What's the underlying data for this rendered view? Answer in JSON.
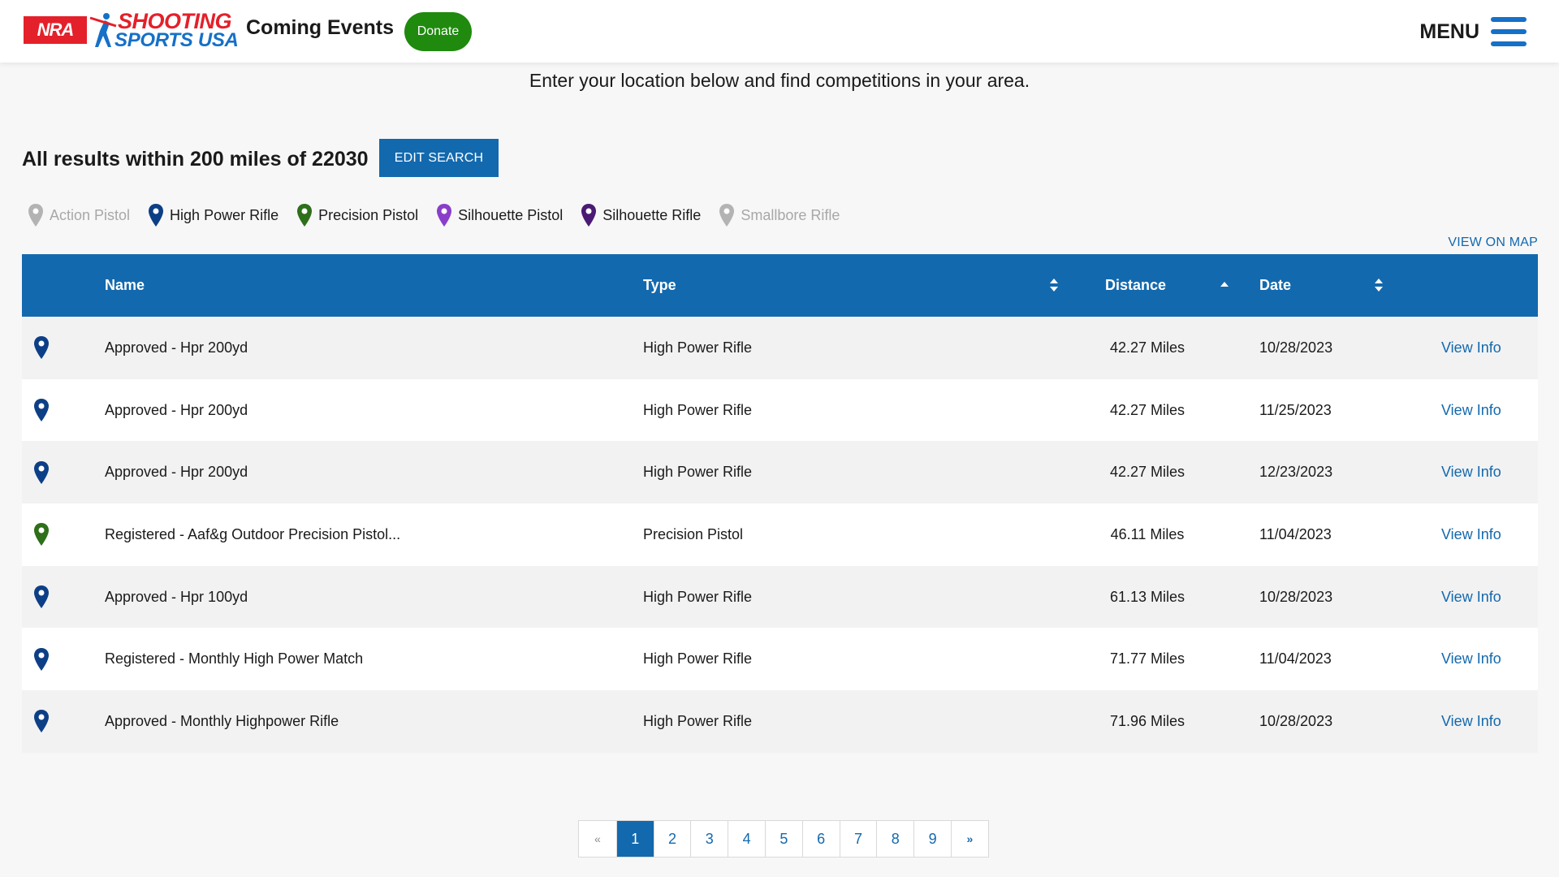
{
  "header": {
    "logo_nra": "NRA",
    "logo_top": "SHOOTING",
    "logo_bottom": "SPORTS USA",
    "title": "Coming Events",
    "donate_label": "Donate",
    "menu_label": "MENU"
  },
  "intro": "Enter your location below and find competitions in your area.",
  "results": {
    "heading": "All results within 200 miles of 22030",
    "edit_label": "EDIT SEARCH"
  },
  "legend": [
    {
      "label": "Action Pistol",
      "color": "#b3b3b3",
      "active": false
    },
    {
      "label": "High Power Rifle",
      "color": "#0d3f86",
      "active": true
    },
    {
      "label": "Precision Pistol",
      "color": "#2e6f1a",
      "active": true
    },
    {
      "label": "Silhouette Pistol",
      "color": "#8a3ec9",
      "active": true
    },
    {
      "label": "Silhouette Rifle",
      "color": "#4a1a74",
      "active": true
    },
    {
      "label": "Smallbore Rifle",
      "color": "#b3b3b3",
      "active": false
    }
  ],
  "view_map_label": "VIEW ON MAP",
  "table": {
    "columns": {
      "name": "Name",
      "type": "Type",
      "distance": "Distance",
      "date": "Date"
    },
    "rows": [
      {
        "pin_color": "#0d3f86",
        "name": "Approved - Hpr 200yd",
        "type": "High Power Rifle",
        "distance": "42.27 Miles",
        "date": "10/28/2023",
        "action": "View Info"
      },
      {
        "pin_color": "#0d3f86",
        "name": "Approved - Hpr 200yd",
        "type": "High Power Rifle",
        "distance": "42.27 Miles",
        "date": "11/25/2023",
        "action": "View Info"
      },
      {
        "pin_color": "#0d3f86",
        "name": "Approved - Hpr 200yd",
        "type": "High Power Rifle",
        "distance": "42.27 Miles",
        "date": "12/23/2023",
        "action": "View Info"
      },
      {
        "pin_color": "#2e6f1a",
        "name": "Registered - Aaf&g Outdoor Precision Pistol...",
        "type": "Precision Pistol",
        "distance": "46.11 Miles",
        "date": "11/04/2023",
        "action": "View Info"
      },
      {
        "pin_color": "#0d3f86",
        "name": "Approved - Hpr 100yd",
        "type": "High Power Rifle",
        "distance": "61.13 Miles",
        "date": "10/28/2023",
        "action": "View Info"
      },
      {
        "pin_color": "#0d3f86",
        "name": "Registered - Monthly High Power Match",
        "type": "High Power Rifle",
        "distance": "71.77 Miles",
        "date": "11/04/2023",
        "action": "View Info"
      },
      {
        "pin_color": "#0d3f86",
        "name": "Approved - Monthly Highpower Rifle",
        "type": "High Power Rifle",
        "distance": "71.96 Miles",
        "date": "10/28/2023",
        "action": "View Info"
      }
    ]
  },
  "pagination": {
    "prev": "«",
    "next": "»",
    "pages": [
      "1",
      "2",
      "3",
      "4",
      "5",
      "6",
      "7",
      "8",
      "9"
    ],
    "current": "1"
  },
  "colors": {
    "brand_blue": "#1369ae",
    "donate_green": "#1f8a0e",
    "nra_red": "#e4202a"
  }
}
